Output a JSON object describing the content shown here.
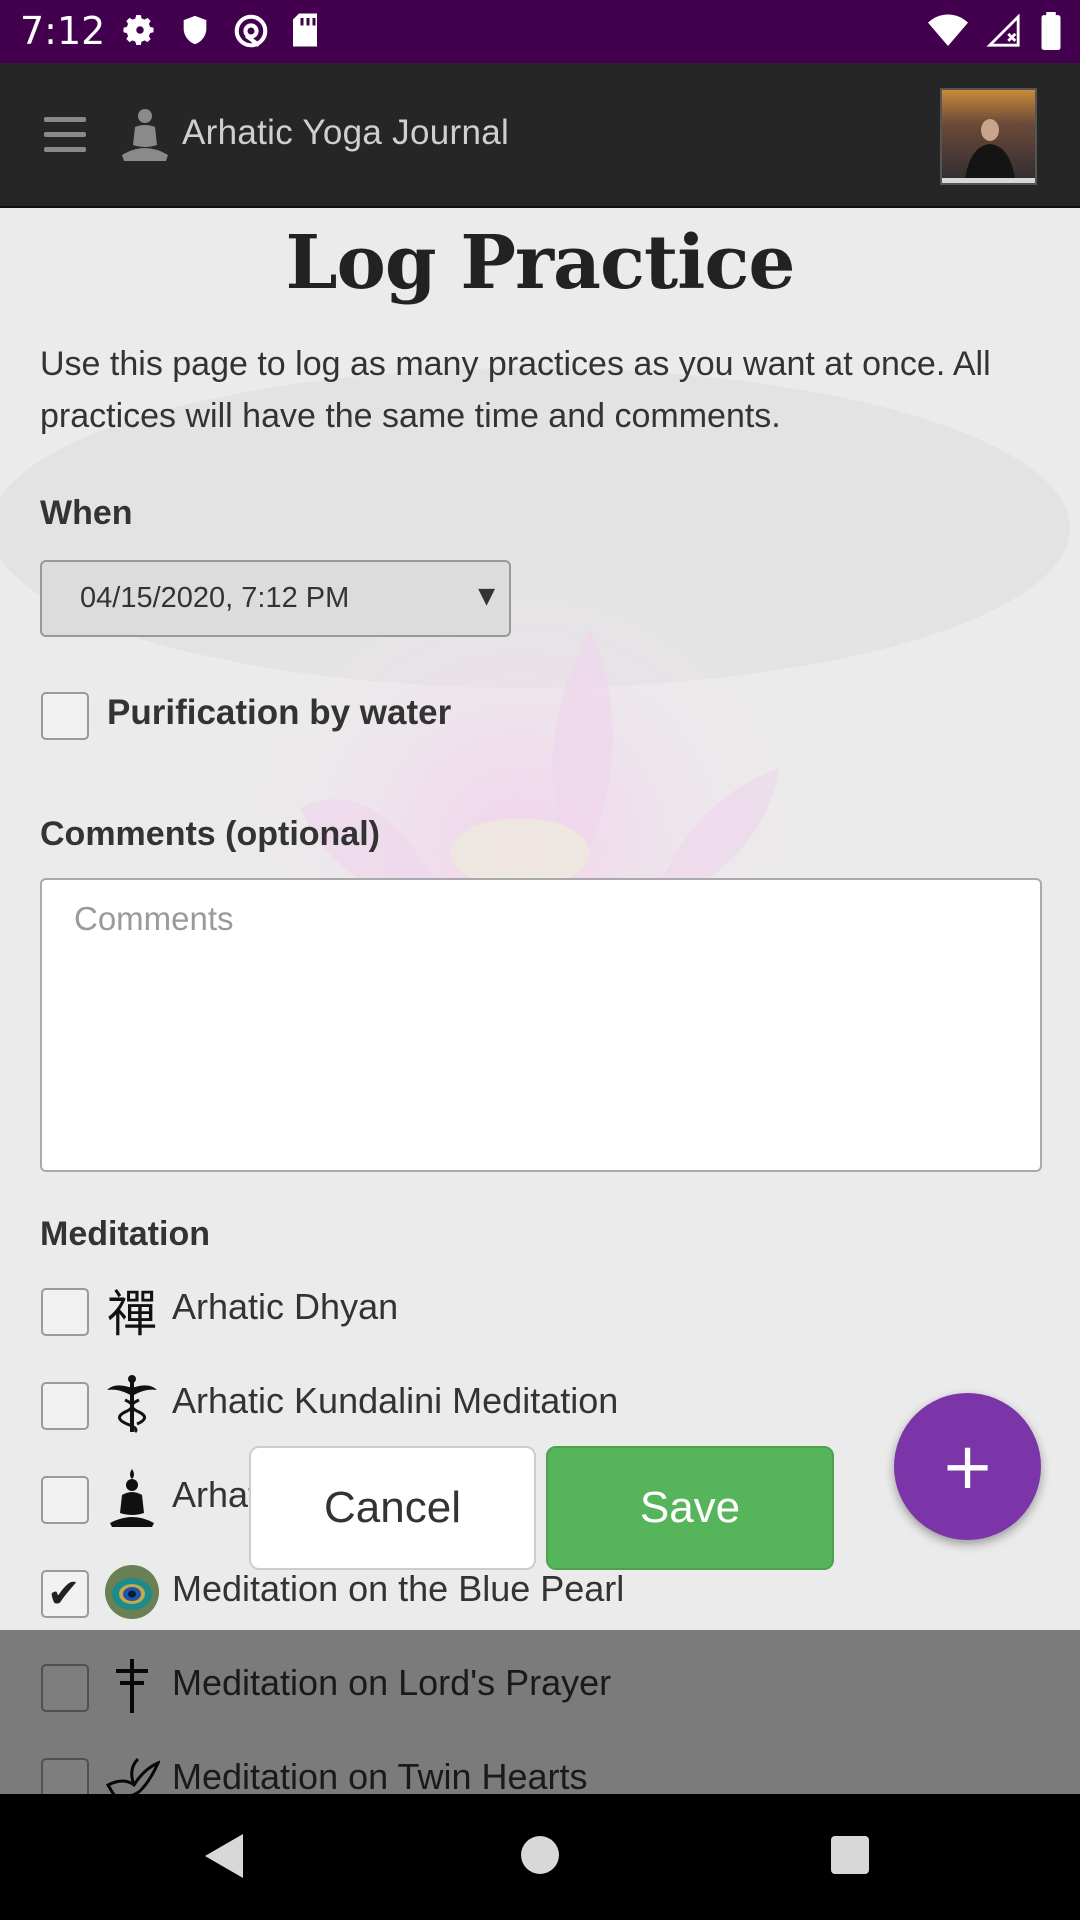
{
  "status_bar": {
    "time": "7:12",
    "left_icons": [
      "gear-icon",
      "shield-icon",
      "at-sign-icon",
      "sd-card-icon"
    ],
    "right_icons": [
      "wifi-icon",
      "signal-icon",
      "battery-icon"
    ]
  },
  "app_bar": {
    "title": "Arhatic Yoga Journal",
    "menu_icon": "hamburger-menu-icon",
    "logo_icon": "meditating-figure-icon"
  },
  "page": {
    "title": "Log Practice",
    "intro": "Use this page to log as many practices as you want at once. All practices will have the same time and comments.",
    "when_label": "When",
    "when_value": "04/15/2020, 7:12 PM",
    "purification_label": "Purification by water",
    "purification_checked": false,
    "comments_label": "Comments (optional)",
    "comments_placeholder": "Comments",
    "comments_value": "",
    "meditation_label": "Meditation"
  },
  "meditations": [
    {
      "label": "Arhatic Dhyan",
      "checked": false,
      "icon": "zen-character-icon"
    },
    {
      "label": "Arhatic Kundalini Meditation",
      "checked": false,
      "icon": "caduceus-icon"
    },
    {
      "label": "Arhatic Level",
      "checked": false,
      "icon": "meditating-silhouette-icon"
    },
    {
      "label": "Meditation on the Blue Pearl",
      "checked": true,
      "icon": "blue-pearl-icon"
    },
    {
      "label": "Meditation on Lord's Prayer",
      "checked": false,
      "icon": "cross-icon"
    },
    {
      "label": "Meditation on Twin Hearts",
      "checked": false,
      "icon": "dove-icon"
    }
  ],
  "actions": {
    "cancel_label": "Cancel",
    "save_label": "Save",
    "fab_label": "+"
  },
  "colors": {
    "status_bar": "#42004f",
    "app_bar": "#262626",
    "save": "#56b55a",
    "fab": "#7b35a8"
  }
}
